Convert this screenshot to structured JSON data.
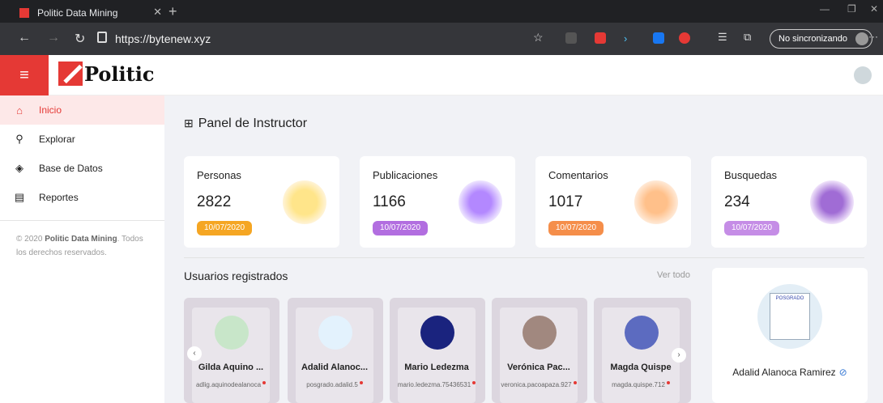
{
  "browser": {
    "tab_title": "Politic Data Mining",
    "url": "https://bytenew.xyz",
    "sync_label": "No sincronizando"
  },
  "app": {
    "logo_text": "Politic"
  },
  "sidebar": {
    "items": [
      {
        "label": "Inicio",
        "icon": "home-icon",
        "active": true
      },
      {
        "label": "Explorar",
        "icon": "search-icon",
        "active": false
      },
      {
        "label": "Base de Datos",
        "icon": "layers-icon",
        "active": false
      },
      {
        "label": "Reportes",
        "icon": "clipboard-icon",
        "active": false
      }
    ],
    "copyright_prefix": "© 2020",
    "copyright_brand": "Politic Data Mining",
    "copyright_suffix": ". Todos los derechos reservados."
  },
  "panel": {
    "title": "Panel de Instructor"
  },
  "stats": [
    {
      "label": "Personas",
      "value": "2822",
      "date": "10/07/2020",
      "color": "#f5a623",
      "icon": "trophy-icon"
    },
    {
      "label": "Publicaciones",
      "value": "1166",
      "date": "10/07/2020",
      "color": "#b26ee0",
      "icon": "laptop-graduation-icon"
    },
    {
      "label": "Comentarios",
      "value": "1017",
      "date": "10/07/2020",
      "color": "#f58e4a",
      "icon": "book-icon"
    },
    {
      "label": "Busquedas",
      "value": "234",
      "date": "10/07/2020",
      "color": "#c58de6",
      "icon": "graduation-network-icon"
    }
  ],
  "users_section": {
    "title": "Usuarios registrados",
    "view_all": "Ver todo"
  },
  "users": [
    {
      "name": "Gilda Aquino ...",
      "handle": "adlig.aquinodealanoca"
    },
    {
      "name": "Adalid Alanoc...",
      "handle": "posgrado.adalid.5"
    },
    {
      "name": "Mario Ledezma",
      "handle": "mario.ledezma.75436531"
    },
    {
      "name": "Verónica Pac...",
      "handle": "veronica.pacoapaza.927"
    },
    {
      "name": "Magda Quispe",
      "handle": "magda.quispe.712"
    }
  ],
  "profile": {
    "name": "Adalid Alanoca Ramirez",
    "poster_title": "POSGRADO"
  }
}
